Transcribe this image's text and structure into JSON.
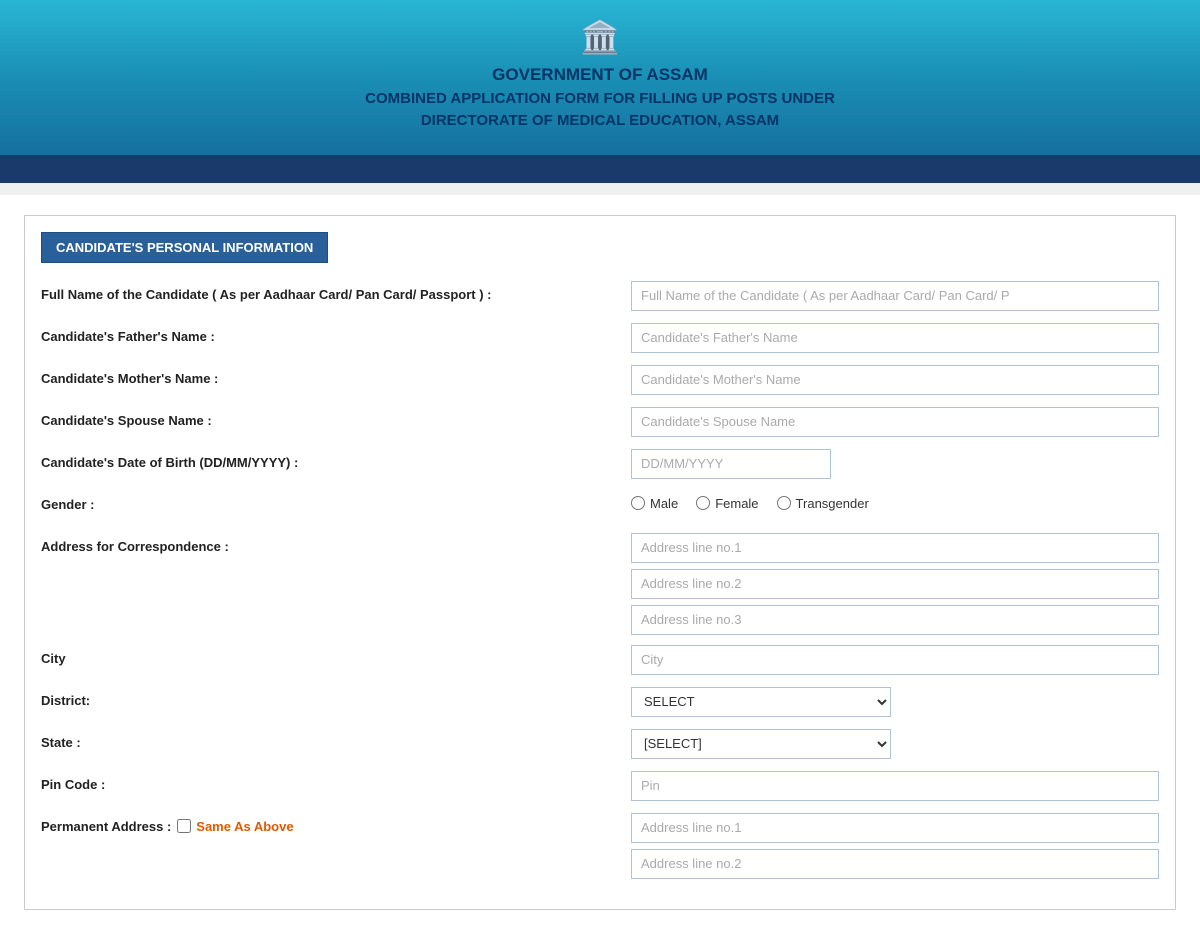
{
  "header": {
    "emblem": "🏛",
    "line1": "GOVERNMENT OF ASSAM",
    "line2": "COMBINED APPLICATION FORM FOR FILLING UP POSTS UNDER",
    "line3": "DIRECTORATE OF MEDICAL EDUCATION, ASSAM"
  },
  "section": {
    "title": "CANDIDATE'S PERSONAL INFORMATION"
  },
  "form": {
    "full_name_label": "Full Name of the Candidate ( As per Aadhaar Card/ Pan Card/ Passport ) :",
    "full_name_placeholder": "Full Name of the Candidate ( As per Aadhaar Card/ Pan Card/ P",
    "father_name_label": "Candidate's Father's Name :",
    "father_name_placeholder": "Candidate's Father's Name",
    "mother_name_label": "Candidate's Mother's Name :",
    "mother_name_placeholder": "Candidate's Mother's Name",
    "spouse_name_label": "Candidate's Spouse Name :",
    "spouse_name_placeholder": "Candidate's Spouse Name",
    "dob_label": "Candidate's Date of Birth (DD/MM/YYYY) :",
    "dob_placeholder": "DD/MM/YYYY",
    "gender_label": "Gender :",
    "gender_options": [
      "Male",
      "Female",
      "Transgender"
    ],
    "address_label": "Address for Correspondence :",
    "address1_placeholder": "Address line no.1",
    "address2_placeholder": "Address line no.2",
    "address3_placeholder": "Address line no.3",
    "city_label": "City",
    "city_placeholder": "City",
    "district_label": "District:",
    "district_default": "SELECT",
    "state_label": "State :",
    "state_default": "[SELECT]",
    "pincode_label": "Pin Code :",
    "pincode_placeholder": "Pin",
    "permanent_label": "Permanent Address :",
    "same_as_above": "Same As Above",
    "perm_address1_placeholder": "Address line no.1",
    "perm_address2_placeholder": "Address line no.2"
  }
}
